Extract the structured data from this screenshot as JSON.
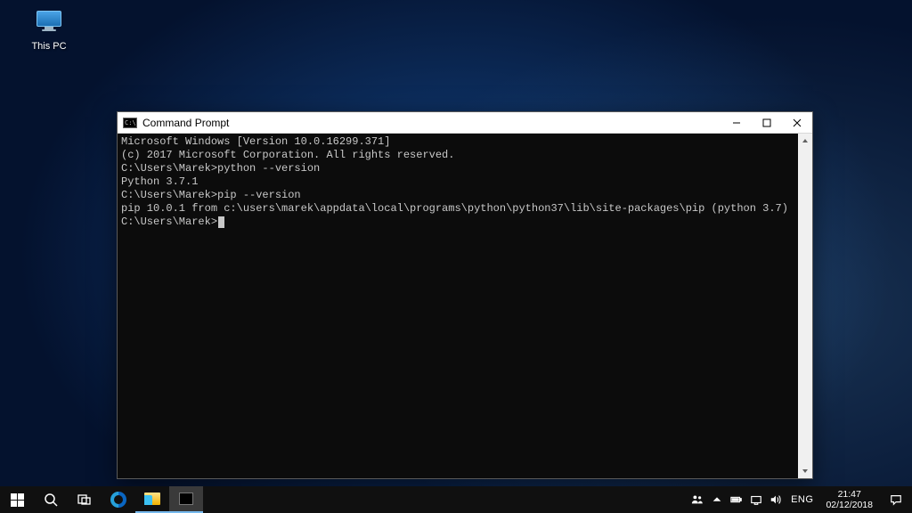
{
  "desktop": {
    "icons": [
      {
        "name": "This PC"
      }
    ]
  },
  "window": {
    "title": "Command Prompt",
    "terminal": {
      "lines": [
        "Microsoft Windows [Version 10.0.16299.371]",
        "(c) 2017 Microsoft Corporation. All rights reserved.",
        "",
        "C:\\Users\\Marek>python --version",
        "Python 3.7.1",
        "",
        "C:\\Users\\Marek>pip --version",
        "pip 10.0.1 from c:\\users\\marek\\appdata\\local\\programs\\python\\python37\\lib\\site-packages\\pip (python 3.7)",
        "",
        "C:\\Users\\Marek>"
      ]
    }
  },
  "taskbar": {
    "language": "ENG",
    "clock": {
      "time": "21:47",
      "date": "02/12/2018"
    }
  }
}
